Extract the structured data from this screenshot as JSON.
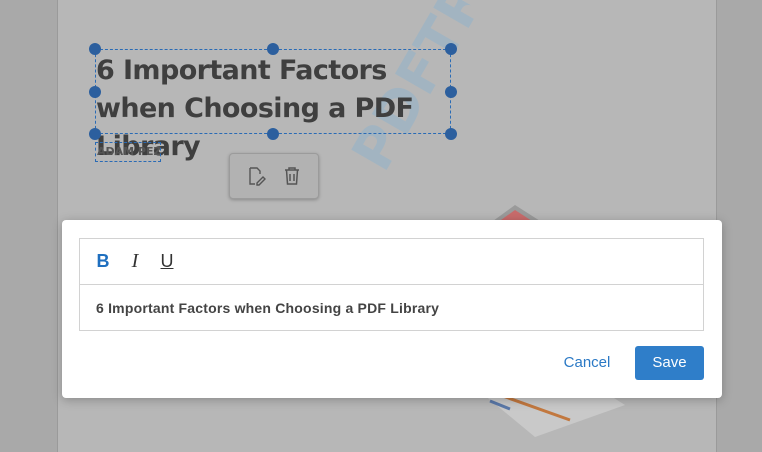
{
  "document": {
    "title": "6 Important Factors when Choosing a PDF Library",
    "author": "ADAM PEZ",
    "watermark_text": "PDFTRON"
  },
  "context_toolbar": {
    "edit_icon": "edit-pencil-icon",
    "delete_icon": "trash-icon"
  },
  "dialog": {
    "format_buttons": {
      "bold": "B",
      "italic": "I",
      "underline": "U"
    },
    "text_value": "6 Important Factors when Choosing a PDF Library",
    "cancel_label": "Cancel",
    "save_label": "Save",
    "accent_color": "#2f7ec9"
  }
}
